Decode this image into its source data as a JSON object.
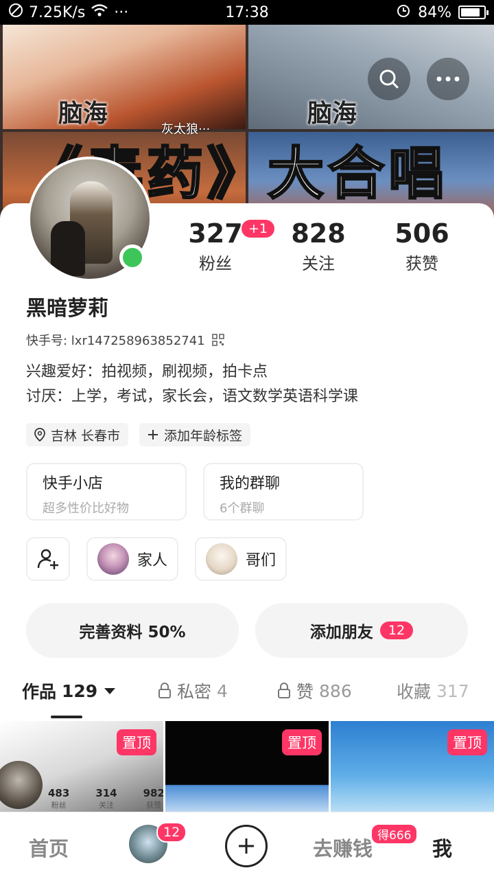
{
  "status_bar": {
    "speed": "7.25K/s",
    "dots": "···",
    "time": "17:38",
    "battery": "84%",
    "battery_level": 0.84
  },
  "banner": {
    "watermark_left": "脑海",
    "watermark_right": "脑海",
    "caption": "灰太狼···",
    "title": "《毒药》大合唱"
  },
  "profile": {
    "stats": {
      "fans": {
        "value": "327",
        "label": "粉丝",
        "badge": "+1"
      },
      "following": {
        "value": "828",
        "label": "关注"
      },
      "likes": {
        "value": "506",
        "label": "获赞"
      }
    },
    "name": "黑暗萝莉",
    "uid_label": "快手号: lxr147258963852741",
    "bio_line1": "兴趣爱好：拍视频，刷视频，拍卡点",
    "bio_line2": "讨厌：上学，考试，家长会，语文数学英语科学课",
    "tags": {
      "location": "吉林 长春市",
      "add_age": "添加年龄标签"
    },
    "tiles": [
      {
        "title": "快手小店",
        "subtitle": "超多性价比好物"
      },
      {
        "title": "我的群聊",
        "subtitle": "6个群聊"
      }
    ],
    "chips": {
      "family": "家人",
      "bros": "哥们"
    },
    "actions": {
      "complete": "完善资料 50%",
      "add_friend": "添加朋友",
      "add_friend_badge": "12"
    }
  },
  "tabs": {
    "works_label": "作品",
    "works_count": "129",
    "private_label": "私密",
    "private_count": "4",
    "liked_label": "赞",
    "liked_count": "886",
    "fav_label": "收藏",
    "fav_count": "317"
  },
  "grid": {
    "pin_label": "置顶",
    "mini": {
      "fans": "483",
      "fans_l": "粉丝",
      "follow": "314",
      "follow_l": "关注",
      "likes": "982",
      "likes_l": "获赞"
    }
  },
  "bottom_nav": {
    "home": "首页",
    "follow_badge": "12",
    "earn": "去赚钱",
    "earn_badge": "得666",
    "me": "我"
  },
  "colors": {
    "accent": "#fe3666",
    "online": "#3dc55a"
  }
}
